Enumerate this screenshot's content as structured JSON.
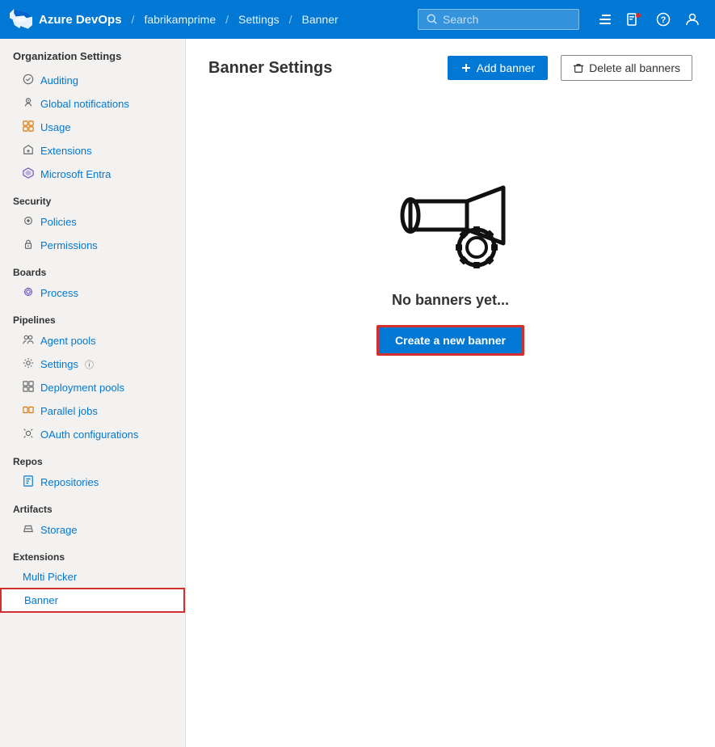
{
  "topnav": {
    "brand": "Azure DevOps",
    "breadcrumb": [
      {
        "label": "fabrikamprime",
        "sep": "/"
      },
      {
        "label": "Settings",
        "sep": "/"
      },
      {
        "label": "Banner",
        "sep": ""
      }
    ],
    "search_placeholder": "Search",
    "icons": [
      "list-icon",
      "badge-icon",
      "help-icon",
      "user-icon"
    ]
  },
  "sidebar": {
    "title": "Organization Settings",
    "sections": [
      {
        "label": "",
        "items": [
          {
            "id": "auditing",
            "label": "Auditing",
            "icon": "🔊"
          },
          {
            "id": "global-notifications",
            "label": "Global notifications",
            "icon": "🔔"
          },
          {
            "id": "usage",
            "label": "Usage",
            "icon": "📦"
          },
          {
            "id": "extensions",
            "label": "Extensions",
            "icon": "🔧"
          },
          {
            "id": "microsoft-entra",
            "label": "Microsoft Entra",
            "icon": "◆"
          }
        ]
      },
      {
        "label": "Security",
        "items": [
          {
            "id": "policies",
            "label": "Policies",
            "icon": "💡"
          },
          {
            "id": "permissions",
            "label": "Permissions",
            "icon": "🔒"
          }
        ]
      },
      {
        "label": "Boards",
        "items": [
          {
            "id": "process",
            "label": "Process",
            "icon": "⚙"
          }
        ]
      },
      {
        "label": "Pipelines",
        "items": [
          {
            "id": "agent-pools",
            "label": "Agent pools",
            "icon": "👥"
          },
          {
            "id": "settings",
            "label": "Settings",
            "icon": "⚙"
          },
          {
            "id": "deployment-pools",
            "label": "Deployment pools",
            "icon": "⊞"
          },
          {
            "id": "parallel-jobs",
            "label": "Parallel jobs",
            "icon": "▣"
          },
          {
            "id": "oauth-configurations",
            "label": "OAuth configurations",
            "icon": "🔑"
          }
        ]
      },
      {
        "label": "Repos",
        "items": [
          {
            "id": "repositories",
            "label": "Repositories",
            "icon": "📁"
          }
        ]
      },
      {
        "label": "Artifacts",
        "items": [
          {
            "id": "storage",
            "label": "Storage",
            "icon": "📊"
          }
        ]
      },
      {
        "label": "Extensions",
        "items": [
          {
            "id": "multi-picker",
            "label": "Multi Picker",
            "icon": ""
          },
          {
            "id": "banner",
            "label": "Banner",
            "icon": "",
            "active": true
          }
        ]
      }
    ]
  },
  "content": {
    "title": "Banner Settings",
    "add_banner_label": "+ Add banner",
    "delete_banners_label": "Delete all banners",
    "empty_state": {
      "message": "No banners yet...",
      "create_button_label": "Create a new banner"
    }
  }
}
